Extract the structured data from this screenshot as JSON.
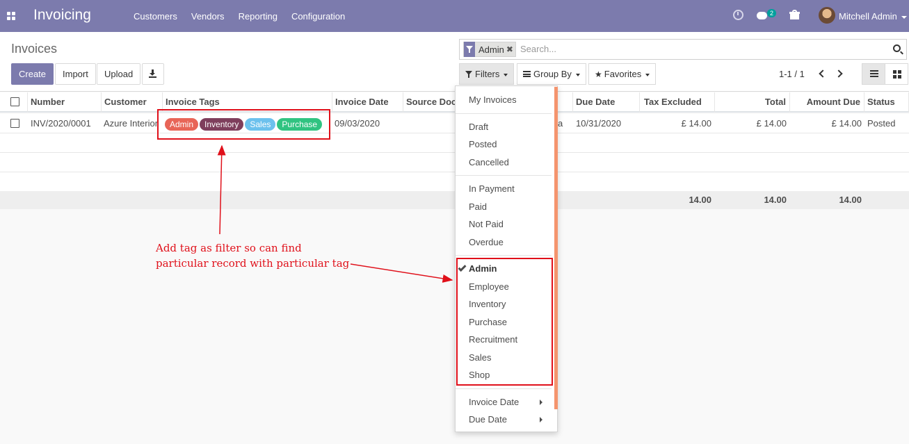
{
  "app": {
    "title": "Invoicing",
    "menu": [
      "Customers",
      "Vendors",
      "Reporting",
      "Configuration"
    ],
    "chat_badge": "2",
    "user_name": "Mitchell Admin"
  },
  "control": {
    "breadcrumb": "Invoices",
    "buttons": {
      "create": "Create",
      "import": "Import",
      "upload": "Upload"
    },
    "search": {
      "facet": "Admin",
      "placeholder": "Search..."
    },
    "filters_label": "Filters",
    "groupby_label": "Group By",
    "favorites_label": "Favorites",
    "pager": "1-1 / 1"
  },
  "table": {
    "columns": [
      "Number",
      "Customer",
      "Invoice Tags",
      "Invoice Date",
      "Source Doc",
      "Due Date",
      "Tax Excluded",
      "Total",
      "Amount Due",
      "Status"
    ],
    "row": {
      "number": "INV/2020/0001",
      "customer": "Azure Interior",
      "tags": [
        "Admin",
        "Inventory",
        "Sales",
        "Purchase"
      ],
      "invoice_date": "09/03/2020",
      "source_doc_tail": "a",
      "due_date": "10/31/2020",
      "tax_excluded": "£ 14.00",
      "total": "£ 14.00",
      "amount_due": "£ 14.00",
      "status": "Posted"
    },
    "totals": {
      "tax_excluded": "14.00",
      "total": "14.00",
      "amount_due": "14.00"
    }
  },
  "tag_colors": {
    "Admin": "#e86557",
    "Inventory": "#7e3e5c",
    "Sales": "#6cc1ed",
    "Purchase": "#30c381"
  },
  "filters_menu": {
    "group1": [
      "My Invoices"
    ],
    "group2": [
      "Draft",
      "Posted",
      "Cancelled"
    ],
    "group3": [
      "In Payment",
      "Paid",
      "Not Paid",
      "Overdue"
    ],
    "tags": [
      "Admin",
      "Employee",
      "Inventory",
      "Purchase",
      "Recruitment",
      "Sales",
      "Shop"
    ],
    "selected_tag": "Admin",
    "date_filters": [
      "Invoice Date",
      "Due Date"
    ]
  },
  "annotation": {
    "line1": "Add tag as filter so can find",
    "line2": "particular record with particular tag"
  }
}
